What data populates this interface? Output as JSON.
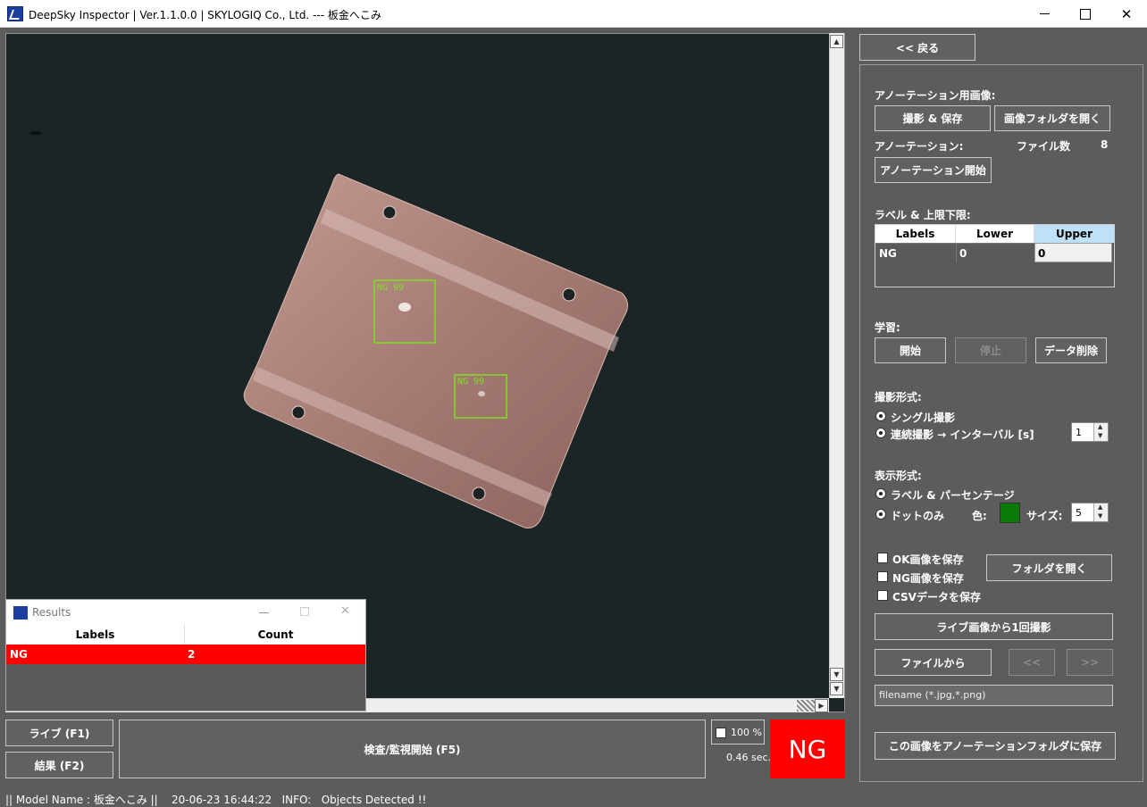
{
  "window": {
    "title": "DeepSky Inspector | Ver.1.1.0.0 | SKYLOGIQ Co., Ltd. --- 板金へこみ",
    "close_glyph": "✕"
  },
  "viewer": {
    "detections": [
      {
        "label": "NG 99"
      },
      {
        "label": "NG 99"
      }
    ]
  },
  "results": {
    "title": "Results",
    "close_glyph": "✕",
    "columns": [
      "Labels",
      "Count"
    ],
    "rows": [
      {
        "label": "NG",
        "count": "2"
      }
    ]
  },
  "bottom": {
    "live_button": "ライブ (F1)",
    "result_button": "結果 (F2)",
    "inspect_button": "検査/監視開始 (F5)",
    "zoom_label": "100 %",
    "elapsed": "0.46 sec.",
    "verdict": "NG"
  },
  "panel": {
    "back_button": "<< 戻る",
    "annotation_images_label": "アノーテーション用画像:",
    "capture_save_button": "撮影 & 保存",
    "open_image_folder_button": "画像フォルダを開く",
    "annotation_label": "アノーテーション:",
    "file_count_label": "ファイル数",
    "file_count": "8",
    "annotation_start_button": "アノーテーション開始",
    "label_limits_label": "ラベル & 上限下限:",
    "table_columns": [
      "Labels",
      "Lower",
      "Upper"
    ],
    "table_rows": [
      {
        "label": "NG",
        "lower": "0",
        "upper": "0"
      }
    ],
    "learning_label": "学習:",
    "learn_start_button": "開始",
    "learn_stop_button": "停止",
    "delete_data_button": "データ削除",
    "capture_mode_label": "撮影形式:",
    "single_capture": "シングル撮影",
    "continuous_capture": "連続撮影 → インターバル [s]",
    "interval_value": "1",
    "display_mode_label": "表示形式:",
    "label_percent": "ラベル & パーセンテージ",
    "dots_only": "ドットのみ",
    "color_label": "色:",
    "dot_color": "#0a7a0a",
    "size_label": "サイズ:",
    "size_value": "5",
    "save_ok": "OK画像を保存",
    "save_ng": "NG画像を保存",
    "save_csv": "CSVデータを保存",
    "open_folder_button": "フォルダを開く",
    "capture_once_button": "ライブ画像から1回撮影",
    "from_file_button": "ファイルから",
    "prev_button": "<<",
    "next_button": ">>",
    "filename_placeholder": "filename (*.jpg,*.png)",
    "save_to_annotation_button": "この画像をアノーテーションフォルダに保存"
  },
  "status": {
    "text": "|| Model Name : 板金へこみ ||    20-06-23 16:44:22   INFO:   Objects Detected !!"
  },
  "colors": {
    "ng_red": "#ff0000",
    "detection_green": "#7ee01e",
    "panel_gray": "#5c5c5c",
    "upper_header": "#bfe0f6"
  }
}
